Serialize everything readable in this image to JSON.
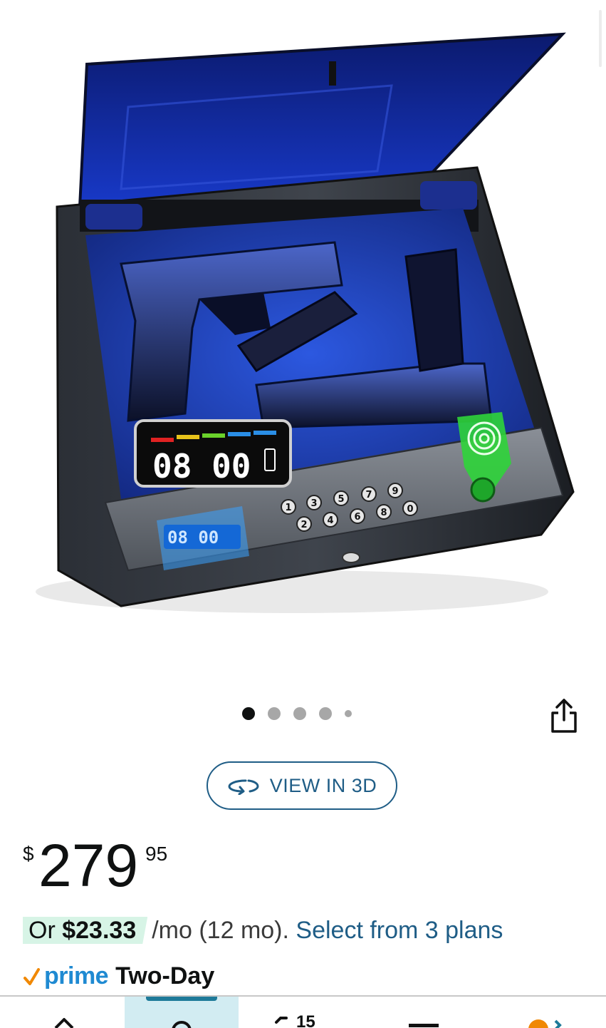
{
  "product": {
    "image_alt": "Biometric gun safe with fingerprint reader, keypad and LED clock display"
  },
  "carousel": {
    "dots": 5,
    "active_index": 0
  },
  "view_3d": {
    "label": "VIEW IN 3D"
  },
  "price": {
    "currency_symbol": "$",
    "whole": "279",
    "fraction": "95"
  },
  "installments": {
    "prefix": "Or",
    "amount": "$23.33",
    "term": "/mo (12 mo).",
    "link": "Select from 3 plans"
  },
  "delivery": {
    "prime_label": "prime",
    "speed": "Two-Day"
  },
  "bottom_nav": {
    "items": [
      "home",
      "search",
      "cart",
      "menu",
      "account"
    ],
    "active": "search",
    "cart_count": "15"
  },
  "colors": {
    "link": "#1f5d86",
    "prime_blue": "#1f8ad2",
    "prime_check": "#f08804",
    "installment_highlight": "#d7f4e6",
    "nav_active_bg": "#d2ecf2"
  }
}
